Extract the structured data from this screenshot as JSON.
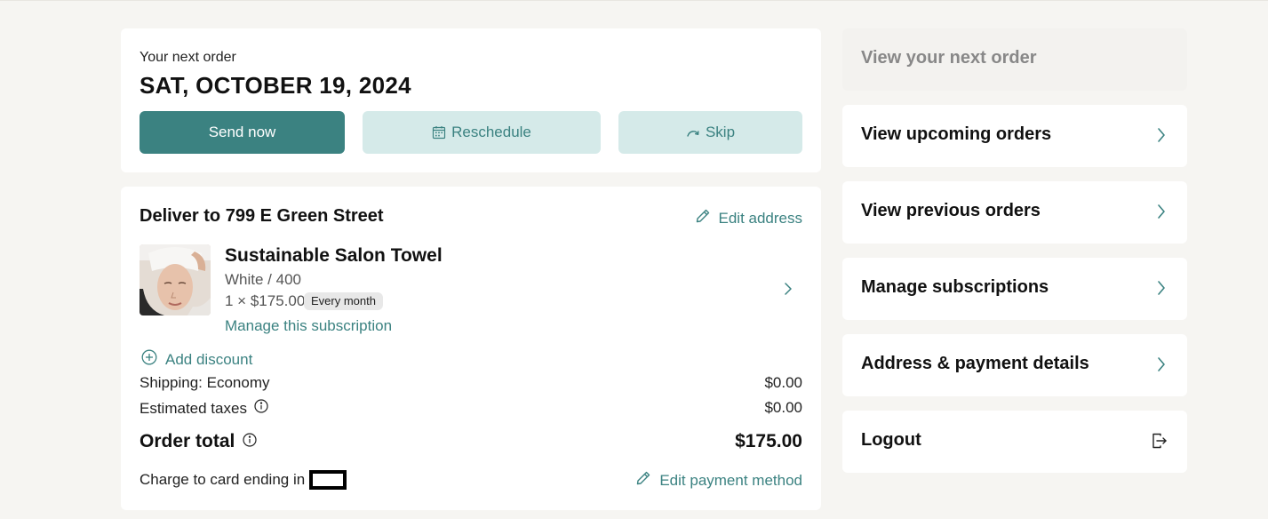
{
  "next_order": {
    "label": "Your next order",
    "date": "SAT, OCTOBER 19, 2024",
    "send_now": "Send now",
    "reschedule": "Reschedule",
    "skip": "Skip"
  },
  "delivery": {
    "title": "Deliver to 799 E Green Street",
    "edit_address": "Edit address",
    "product": {
      "name": "Sustainable Salon Towel",
      "variant": "White / 400",
      "price": "1 × $175.00",
      "frequency": "Every month",
      "manage": "Manage this subscription"
    },
    "add_discount": "Add discount",
    "shipping_label": "Shipping: Economy",
    "shipping_value": "$0.00",
    "taxes_label": "Estimated taxes",
    "taxes_value": "$0.00",
    "total_label": "Order total",
    "total_value": "$175.00",
    "charge_label": "Charge to card ending in",
    "edit_payment": "Edit payment method"
  },
  "nav": [
    {
      "label": "View your next order",
      "icon": "none",
      "disabled": true
    },
    {
      "label": "View upcoming orders",
      "icon": "chevron-right-icon"
    },
    {
      "label": "View previous orders",
      "icon": "chevron-right-icon"
    },
    {
      "label": "Manage subscriptions",
      "icon": "chevron-right-icon"
    },
    {
      "label": "Address & payment details",
      "icon": "chevron-right-icon"
    },
    {
      "label": "Logout",
      "icon": "logout-icon"
    }
  ],
  "colors": {
    "accent": "#3b8281",
    "accent_light": "#d5eae9",
    "background": "#f6f5f2"
  }
}
